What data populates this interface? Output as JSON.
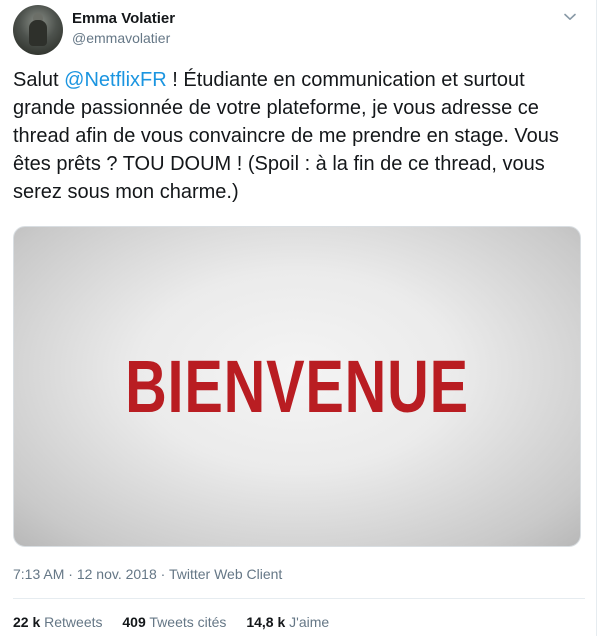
{
  "user": {
    "display_name": "Emma Volatier",
    "screen_name": "@emmavolatier"
  },
  "tweet": {
    "text_before_mention": "Salut ",
    "mention": "@NetflixFR",
    "text_after_mention": " ! Étudiante en communication et surtout grande passionnée de votre plateforme, je vous adresse ce thread afin de vous convaincre de me prendre en stage. Vous êtes prêts ? TOU DOUM ! (Spoil : à la fin de ce thread, vous serez sous mon charme.)",
    "media_text": "BIENVENUE"
  },
  "meta": {
    "time": "7:13 AM",
    "separator_1": " · ",
    "date": "12 nov. 2018",
    "separator_2": " · ",
    "client": "Twitter Web Client"
  },
  "stats": {
    "retweets_count": "22 k",
    "retweets_label": "Retweets",
    "quotes_count": "409",
    "quotes_label": "Tweets cités",
    "likes_count": "14,8 k",
    "likes_label": "J'aime"
  },
  "icons": {
    "caret": "chevron-down-icon"
  },
  "colors": {
    "mention": "#1b95e0",
    "secondary_text": "#657786",
    "media_text": "#b91d22"
  }
}
